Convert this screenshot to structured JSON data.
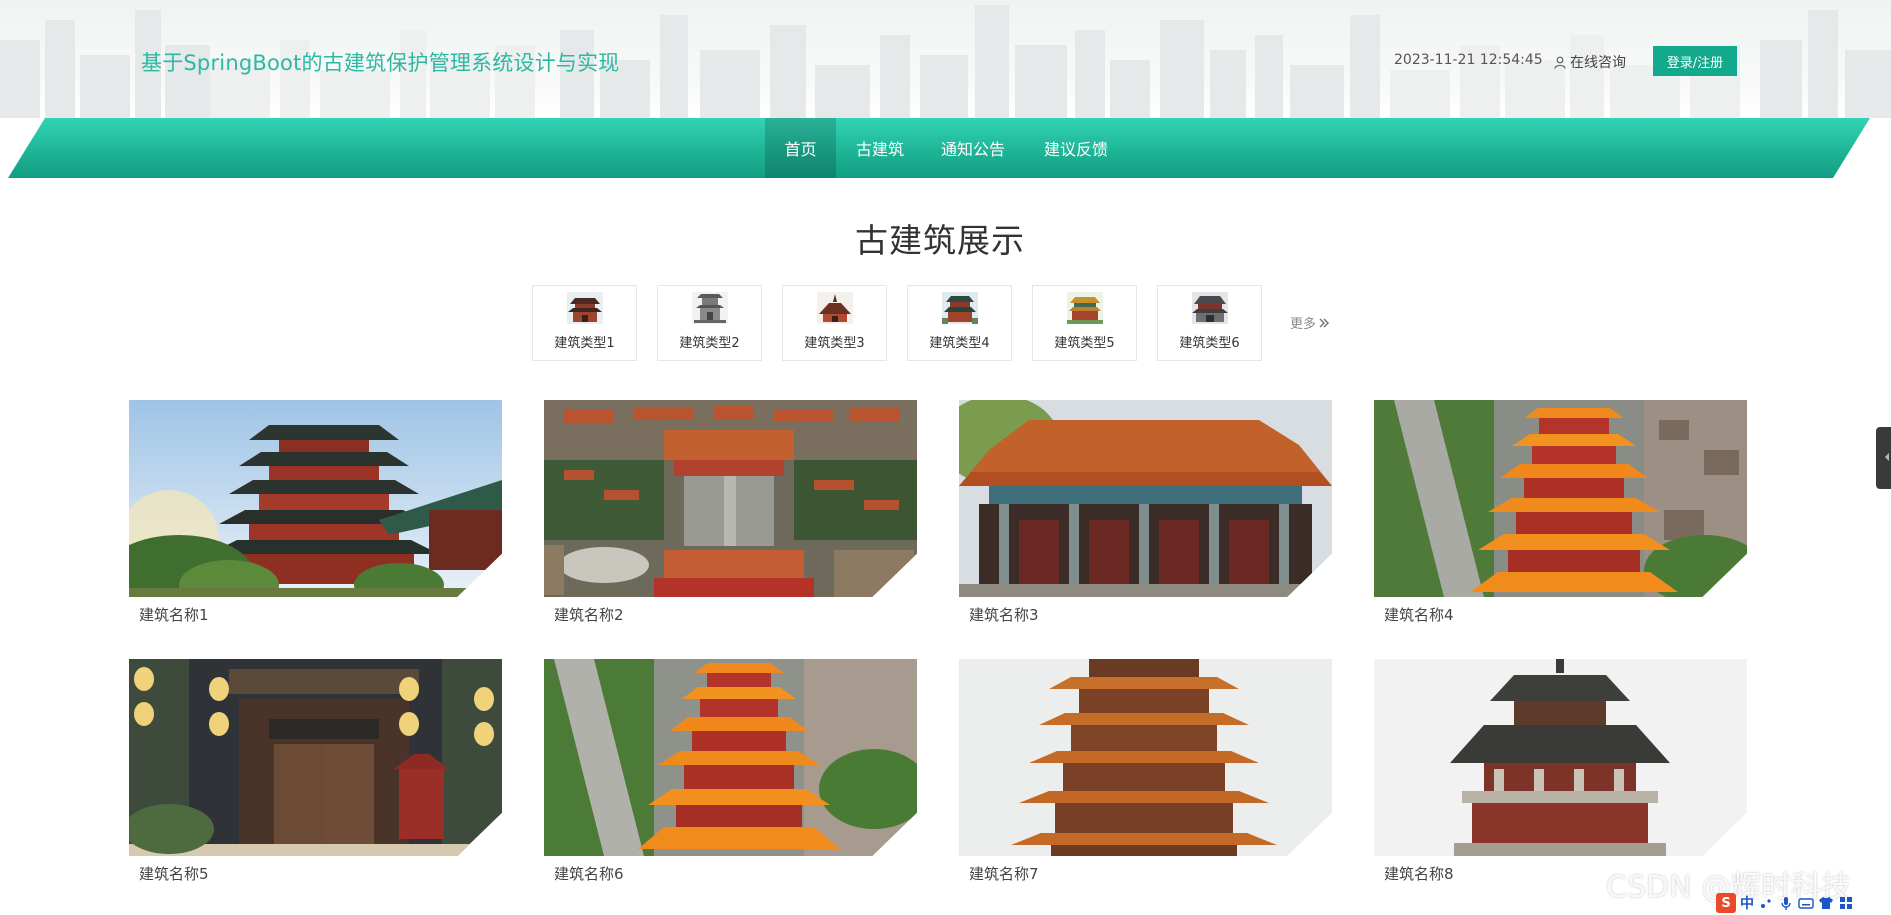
{
  "header": {
    "title": "基于SpringBoot的古建筑保护管理系统设计与实现",
    "datetime": "2023-11-21 12:54:45",
    "consult_label": "在线咨询",
    "login_label": "登录/注册"
  },
  "nav": {
    "items": [
      {
        "label": "首页",
        "active": true
      },
      {
        "label": "古建筑",
        "active": false
      },
      {
        "label": "通知公告",
        "active": false
      },
      {
        "label": "建议反馈",
        "active": false
      }
    ]
  },
  "section": {
    "title": "古建筑展示",
    "more_label": "更多"
  },
  "categories": [
    {
      "label": "建筑类型1"
    },
    {
      "label": "建筑类型2"
    },
    {
      "label": "建筑类型3"
    },
    {
      "label": "建筑类型4"
    },
    {
      "label": "建筑类型5"
    },
    {
      "label": "建筑类型6"
    }
  ],
  "buildings": [
    {
      "name": "建筑名称1"
    },
    {
      "name": "建筑名称2"
    },
    {
      "name": "建筑名称3"
    },
    {
      "name": "建筑名称4"
    },
    {
      "name": "建筑名称5"
    },
    {
      "name": "建筑名称6"
    },
    {
      "name": "建筑名称7"
    },
    {
      "name": "建筑名称8"
    }
  ],
  "overlay": {
    "watermark": "CSDN @辉时科技",
    "ime_logo": "S",
    "ime_lang": "中"
  },
  "colors": {
    "accent": "#13a98d",
    "title_teal": "#2cb9a3",
    "nav_light": "#33d3b5",
    "nav_dark": "#129e84"
  }
}
